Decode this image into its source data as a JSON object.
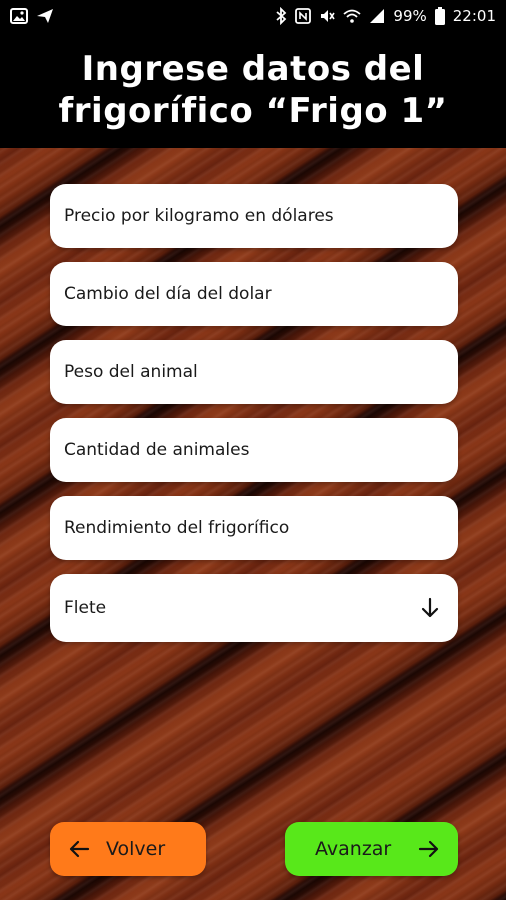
{
  "status_bar": {
    "left_icons": [
      "image-icon",
      "send-icon"
    ],
    "right_icons": [
      "bluetooth-icon",
      "nfc-icon",
      "mute-icon",
      "wifi-icon",
      "signal-icon",
      "battery-icon"
    ],
    "battery_percent": "99%",
    "time": "22:01"
  },
  "header": {
    "title": "Ingrese datos del\nfrigorífico “Frigo 1”"
  },
  "form": {
    "fields": [
      {
        "label": "Precio por kilogramo en dólares"
      },
      {
        "label": "Cambio del día del dolar"
      },
      {
        "label": "Peso del animal"
      },
      {
        "label": "Cantidad de animales"
      },
      {
        "label": "Rendimiento del frigorífico"
      },
      {
        "label": "Flete",
        "icon": "arrow-down-icon"
      }
    ]
  },
  "buttons": {
    "back": {
      "label": "Volver",
      "icon": "arrow-left-icon",
      "color": "#ff7a1a"
    },
    "next": {
      "label": "Avanzar",
      "icon": "arrow-right-icon",
      "color": "#58e81a"
    }
  },
  "colors": {
    "header_bg": "#000000",
    "field_bg": "#ffffff",
    "wood_dark": "#2a0b05",
    "wood_mid": "#7a2d12"
  }
}
